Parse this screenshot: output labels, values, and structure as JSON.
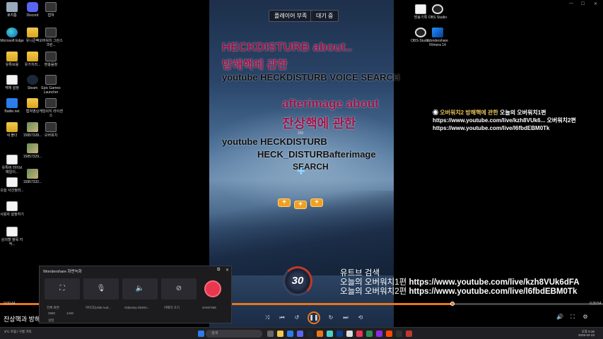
{
  "desktop": {
    "icons": [
      {
        "label": "휴지통",
        "kind": "recycle"
      },
      {
        "label": "Discord",
        "kind": "discord"
      },
      {
        "label": "캡쳐",
        "kind": "app-dark"
      },
      {
        "label": "Microsoft Edge",
        "kind": "edge"
      },
      {
        "label": "유니콘팩",
        "kind": "folder"
      },
      {
        "label": "오버워치 그린스크린...",
        "kind": "app-dark"
      },
      {
        "label": "유튜브용",
        "kind": "folder"
      },
      {
        "label": "유가치라...",
        "kind": "folder"
      },
      {
        "label": "편충움창",
        "kind": "app-dark"
      },
      {
        "label": "캐체 설정",
        "kind": "doc"
      },
      {
        "label": "Steam",
        "kind": "steam"
      },
      {
        "label": "Epic Games Launcher",
        "kind": "app-dark"
      },
      {
        "label": "Battle.net",
        "kind": "app-blue"
      },
      {
        "label": "캡쳐영상",
        "kind": "folder"
      },
      {
        "label": "게임쉬지 라이센스",
        "kind": "app-dark"
      },
      {
        "label": "새 폴더",
        "kind": "folder"
      },
      {
        "label": "15857328...",
        "kind": "photo"
      },
      {
        "label": "오버워치",
        "kind": "app-dark"
      },
      {
        "label": "유튜버 라이브 메일이...",
        "kind": "doc"
      },
      {
        "label": "15857329...",
        "kind": "photo"
      },
      {
        "label": "오늘 사건정리...",
        "kind": "doc"
      },
      {
        "label": "15857332...",
        "kind": "photo"
      },
      {
        "label": "사용자 설정하기",
        "kind": "doc"
      },
      {
        "label": "상의할 항목 지적...",
        "kind": "doc"
      },
      {
        "label": "방송기록",
        "kind": "doc"
      },
      {
        "label": "OBS Studio",
        "kind": "obs"
      },
      {
        "label": "OBS-Studi...",
        "kind": "obs"
      },
      {
        "label": "Wondershare Filmora 14",
        "kind": "ws"
      }
    ]
  },
  "game": {
    "pills": [
      "플레이어 부족",
      "대기 중"
    ],
    "lines": [
      "HECKDISTURB about..",
      "방해핵에 관한",
      "youtube HECKDISTURB VOICE SEARCH",
      "afterimage about",
      "잔상핵에 관한",
      "youtube HECKDISTURB",
      "HECK_DISTURBafterimage",
      "SEARCH"
    ],
    "small_number": "250",
    "timer": "30"
  },
  "chat": {
    "name": "오버워치2 방해핵에 관한",
    "message": "오늘의 오버워치1편 https://www.youtube.com/live/kzh8VUk6... 오버워치2편 https://www.youtube.com/live/l6fbdEBM0Tk"
  },
  "overlay": {
    "line1": "유트브 검색",
    "line2_label": "오늘의 오버워치1편",
    "line2_url": "https://www.youtube.com/live/kzh8VUk6dFA",
    "line3_label": "오늘의 오버워치2편",
    "line3_url": "https://www.youtube.com/live/l6fbdEBM0Tk"
  },
  "player": {
    "time_current": "0:00:44",
    "time_total": "0:30:54",
    "progress": 0.75,
    "caption": "잔상핵과 방해핵"
  },
  "recorder": {
    "title": "Wondershare 화면녹화",
    "labels": [
      "전체 화면",
      "마이크(USB Aud...",
      "Odyssey-2526V...",
      "카메라 끄기",
      "SAM7488"
    ],
    "size_w": "2560",
    "size_h": "1440",
    "settings": "설정"
  },
  "taskbar": {
    "search_placeholder": "검색",
    "weather": "3°C 흐림 / 구름 가득",
    "time": "오후 6:36",
    "date": "2025-02-23"
  },
  "colors": {
    "accent": "#e8761c",
    "magenta_text": "#a0144b",
    "record_red": "#e8384f"
  }
}
